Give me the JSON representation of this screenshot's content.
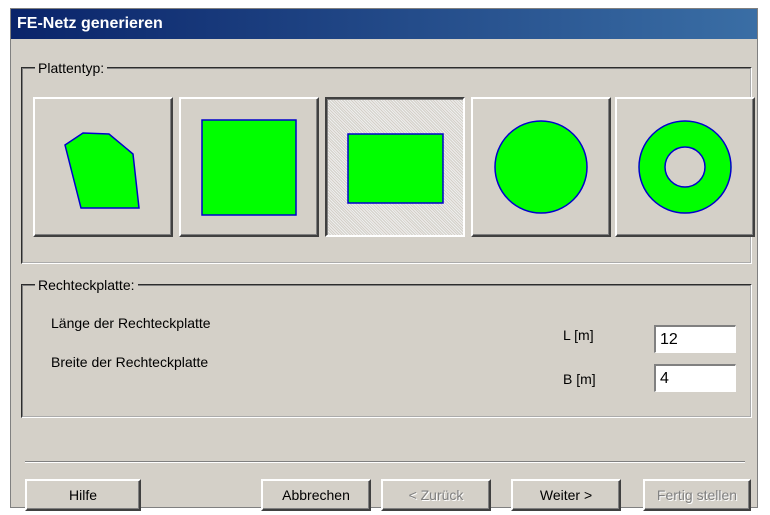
{
  "window": {
    "title": "FE-Netz generieren"
  },
  "plate_group": {
    "legend": "Plattentyp:",
    "buttons": [
      {
        "name": "polygon",
        "icon": "polygon-plate-icon",
        "selected": false
      },
      {
        "name": "square",
        "icon": "square-plate-icon",
        "selected": false
      },
      {
        "name": "rectangle",
        "icon": "rectangle-plate-icon",
        "selected": true
      },
      {
        "name": "circle",
        "icon": "circle-plate-icon",
        "selected": false
      },
      {
        "name": "ring",
        "icon": "ring-plate-icon",
        "selected": false
      }
    ]
  },
  "rect_group": {
    "legend": "Rechteckplatte:",
    "length_label": "Länge der Rechteckplatte",
    "width_label": "Breite der Rechteckplatte",
    "L_label": "L [m]",
    "B_label": "B [m]",
    "L_value": "12",
    "B_value": "4"
  },
  "buttons": {
    "help": "Hilfe",
    "cancel": "Abbrechen",
    "back": "< Zurück",
    "next": "Weiter >",
    "finish": "Fertig stellen"
  },
  "colors": {
    "shape_fill": "#00ff00",
    "shape_stroke": "#0000cc",
    "title_bar": "#0a246a",
    "face": "#d4d0c8"
  }
}
